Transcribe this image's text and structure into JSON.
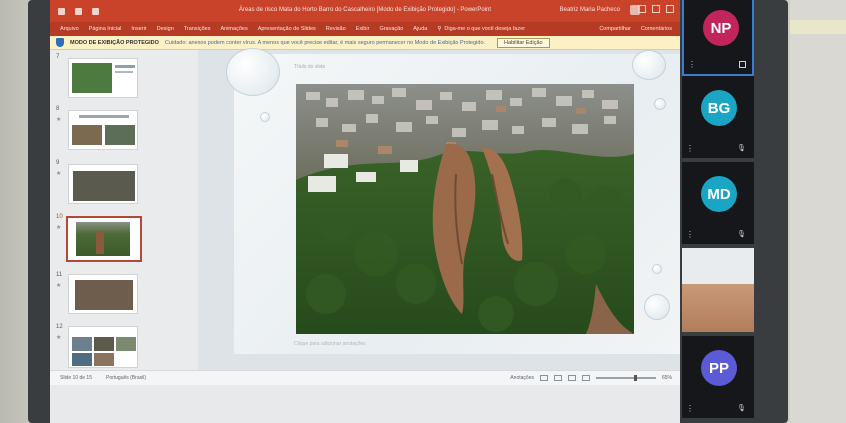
{
  "powerpoint": {
    "title_bar": {
      "doc_title": "Áreas de risco Mata do Horto Barro do Cascalheiro  [Modo de Exibição Protegido]  -  PowerPoint",
      "user_name": "Beatriz Maria Pacheco"
    },
    "tabs": [
      "Arquivo",
      "Página Inicial",
      "Inserir",
      "Design",
      "Transições",
      "Animações",
      "Apresentação de Slides",
      "Revisão",
      "Exibir",
      "Gravação",
      "Ajuda"
    ],
    "tell_me": "Diga-me o que você deseja fazer",
    "tabs_right": [
      "Compartilhar",
      "Comentários"
    ],
    "protected_bar": {
      "label": "MODO DE EXIBIÇÃO PROTEGIDO",
      "message": "Cuidado: anexos podem conter vírus. A menos que você precise editar, é mais seguro permanecer no Modo de Exibição Protegido.",
      "button": "Habilitar Edição"
    },
    "thumbnails": [
      {
        "num": "7",
        "active": false
      },
      {
        "num": "8",
        "active": false
      },
      {
        "num": "9",
        "active": false
      },
      {
        "num": "10",
        "active": true
      },
      {
        "num": "11",
        "active": false
      },
      {
        "num": "12",
        "active": false
      }
    ],
    "slide_title_placeholder": "Título do slide",
    "notes_placeholder": "Clique para adicionar anotações",
    "status": {
      "slide_count": "Slide 10 de 15",
      "language": "Português (Brasil)",
      "notes": "Anotações",
      "zoom": "65%"
    }
  },
  "meeting": {
    "participants": [
      {
        "initials": "NP",
        "color": "#c2255c",
        "speaking": true
      },
      {
        "initials": "BG",
        "color": "#1ba5c4",
        "speaking": false
      },
      {
        "initials": "MD",
        "color": "#1ba5c4",
        "speaking": false
      },
      {
        "initials": "PP",
        "color": "#5b5bd6",
        "speaking": false
      }
    ]
  },
  "colors": {
    "ribbon": "#c9432b",
    "protected_bar": "#fcf1c4",
    "active_thumb_border": "#b04a36"
  }
}
